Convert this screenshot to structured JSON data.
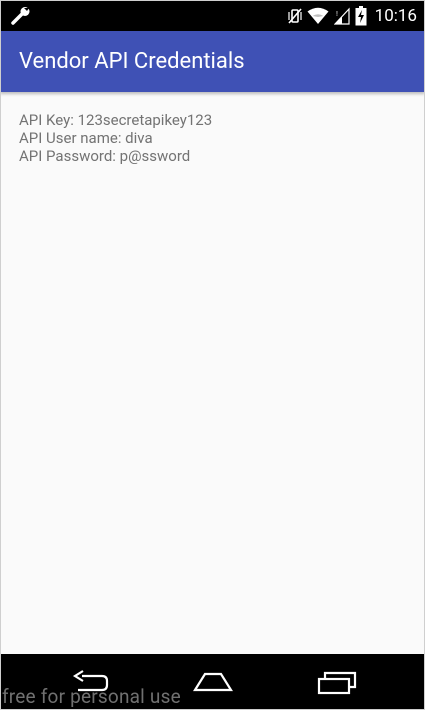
{
  "status_bar": {
    "time": "10:16",
    "icons": [
      "wrench-icon",
      "vibrate-mute-icon",
      "wifi-icon",
      "signal-icon",
      "battery-charging-icon"
    ]
  },
  "app_bar": {
    "title": "Vendor API Credentials",
    "color": "#3f51b5"
  },
  "credentials": {
    "api_key": "API Key: 123secretapikey123",
    "api_user": "API User name: diva",
    "api_password": "API Password: p@ssword"
  },
  "nav_bar": {
    "icons": [
      "back-icon",
      "home-icon",
      "recents-icon"
    ]
  },
  "watermark": "free for personal use"
}
